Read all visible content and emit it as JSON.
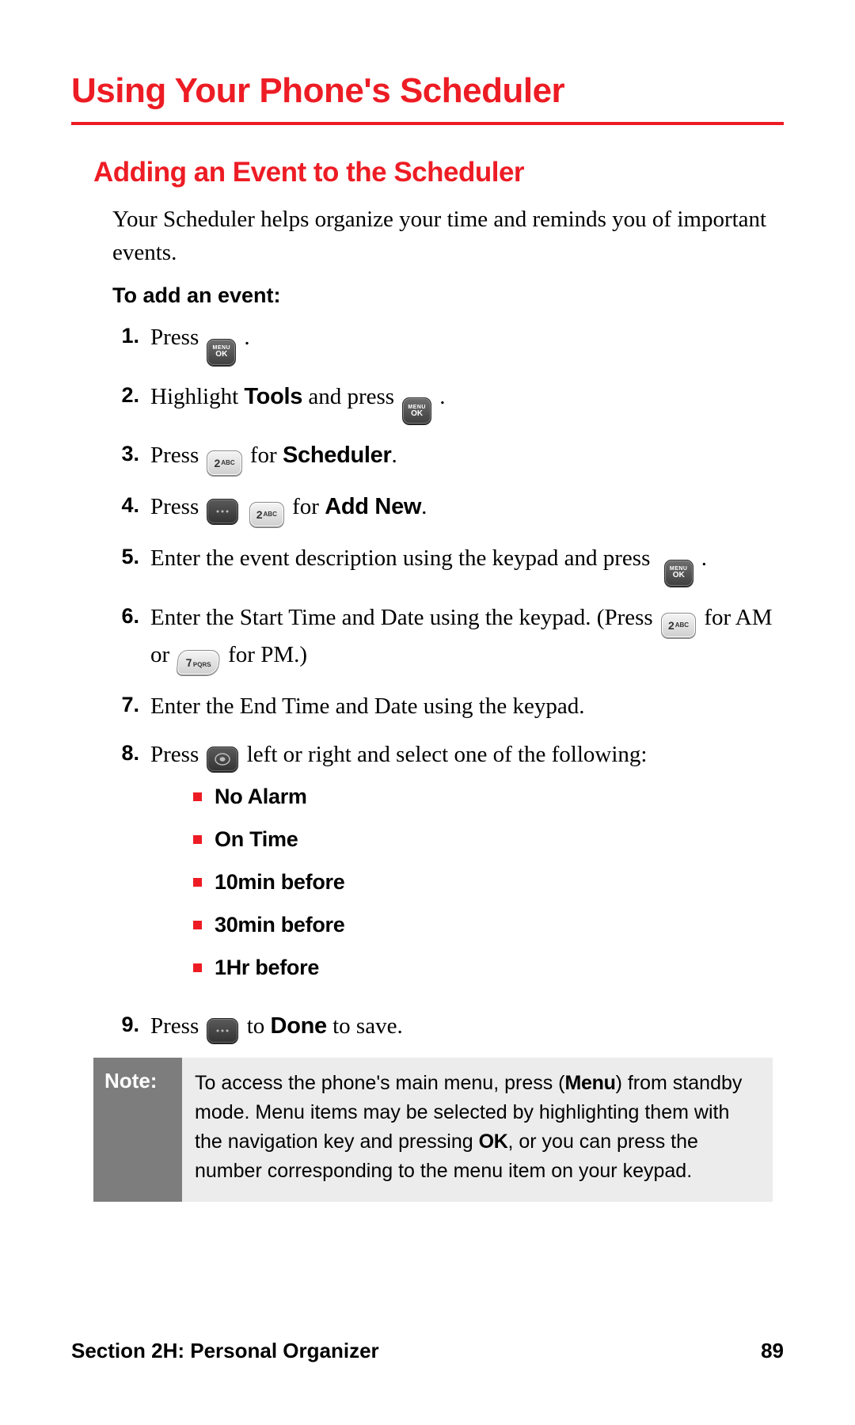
{
  "title": "Using Your Phone's Scheduler",
  "subtitle": "Adding an Event to the Scheduler",
  "intro": "Your Scheduler helps organize your time and reminds you of important events.",
  "lead": "To add an event:",
  "keys": {
    "menu_top": "MENU",
    "menu_bottom": "OK",
    "k2_num": "2",
    "k2_let": "ABC",
    "k7_num": "7",
    "k7_let": "PQRS"
  },
  "steps": {
    "s1": {
      "n": "1.",
      "a": "Press ",
      "b": "."
    },
    "s2": {
      "n": "2.",
      "a": "Highlight ",
      "bold": "Tools",
      "b": " and press ",
      "c": "."
    },
    "s3": {
      "n": "3.",
      "a": "Press ",
      "b": " for ",
      "bold": "Scheduler",
      "c": "."
    },
    "s4": {
      "n": "4.",
      "a": "Press ",
      "b": " ",
      "c": " for ",
      "bold": "Add New",
      "d": "."
    },
    "s5": {
      "n": "5.",
      "a": "Enter the event description using the keypad and press ",
      "b": "."
    },
    "s6": {
      "n": "6.",
      "a": "Enter the Start Time and Date using the keypad. (Press ",
      "b": " for AM or ",
      "c": " for PM.)"
    },
    "s7": {
      "n": "7.",
      "a": "Enter the End Time and Date using the keypad."
    },
    "s8": {
      "n": "8.",
      "a": "Press ",
      "b": " left or right and select one of the following:"
    },
    "s9": {
      "n": "9.",
      "a": "Press ",
      "b": " to ",
      "bold": "Done",
      "c": " to save."
    }
  },
  "bullets": [
    "No Alarm",
    "On Time",
    "10min before",
    "30min before",
    "1Hr before"
  ],
  "note": {
    "label": "Note:",
    "a": "To access the phone's main menu, press (",
    "b1": "Menu",
    "b": ") from standby mode. Menu items may be selected by highlighting them with the navigation key and pressing ",
    "b2": "OK",
    "c": ", or you can press the number corresponding to the menu item on your keypad."
  },
  "footer": {
    "section": "Section 2H: Personal Organizer",
    "page": "89"
  }
}
